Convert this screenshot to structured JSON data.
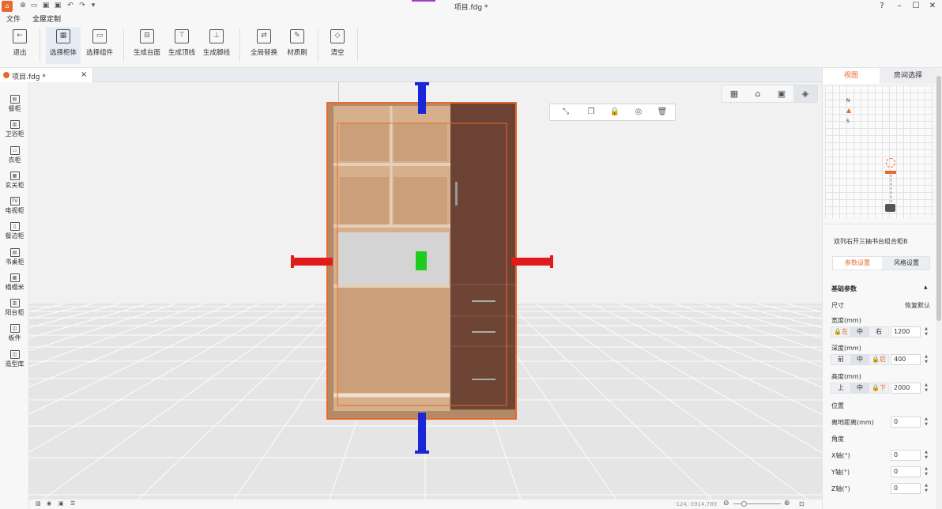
{
  "titlebar": {
    "title": "项目.fdg *",
    "help": "?",
    "min": "–",
    "max": "☐",
    "close": "✕"
  },
  "menu": {
    "items": [
      "文件",
      "全屋定制"
    ]
  },
  "ribbon": {
    "buttons": [
      {
        "label": "退出",
        "icon": "←"
      },
      {
        "label": "选择柜体",
        "icon": "▦"
      },
      {
        "label": "选择组件",
        "icon": "▭"
      },
      {
        "label": "生成台面",
        "icon": "⊟"
      },
      {
        "label": "生成顶线",
        "icon": "⊤"
      },
      {
        "label": "生成脚线",
        "icon": "⊥"
      },
      {
        "label": "全局替换",
        "icon": "⇄"
      },
      {
        "label": "材质刷",
        "icon": "✎"
      },
      {
        "label": "清空",
        "icon": "◇"
      }
    ]
  },
  "doc_tab": {
    "title": "项目.fdg *",
    "close": "×"
  },
  "left_sidebar": {
    "items": [
      {
        "label": "餐柜",
        "icon": "▤"
      },
      {
        "label": "卫浴柜",
        "icon": "▥"
      },
      {
        "label": "衣柜",
        "icon": "▭"
      },
      {
        "label": "玄关柜",
        "icon": "▦"
      },
      {
        "label": "电视柜",
        "icon": "TV"
      },
      {
        "label": "餐边柜",
        "icon": "▯"
      },
      {
        "label": "书桌柜",
        "icon": "▤"
      },
      {
        "label": "榻榻米",
        "icon": "▦"
      },
      {
        "label": "阳台柜",
        "icon": "▥"
      },
      {
        "label": "板件",
        "icon": "◫"
      },
      {
        "label": "造型库",
        "icon": "◫"
      }
    ]
  },
  "viewport": {
    "view_buttons": [
      "▦",
      "⌂",
      "▣",
      "◈"
    ],
    "context_buttons": [
      "⤡",
      "❐",
      "🔒",
      "◎",
      "🗑"
    ]
  },
  "status": {
    "coords": "-124,-3914,789",
    "zoom_minus": "⊖",
    "zoom_plus": "⊕"
  },
  "right_panel": {
    "tabs": [
      "视图",
      "房间选择"
    ],
    "compass_n": "N",
    "compass_s": "S",
    "cabinet_name": "双列右开三抽书台组合柜B",
    "sub_tabs": [
      "参数设置",
      "风格设置"
    ],
    "section_basic": "基础参数",
    "collapse": "▲",
    "size_label": "尺寸",
    "size_default": "恢复默认",
    "width": {
      "label": "宽度(mm)",
      "options": [
        "🔒左",
        "中",
        "右"
      ],
      "value": "1200"
    },
    "depth": {
      "label": "深度(mm)",
      "options": [
        "前",
        "中",
        "🔒后"
      ],
      "value": "400"
    },
    "height": {
      "label": "高度(mm)",
      "options": [
        "上",
        "中",
        "🔒下"
      ],
      "value": "2000"
    },
    "position_label": "位置",
    "floor_dist": {
      "label": "离地距离(mm)",
      "value": "0"
    },
    "angle_label": "角度",
    "x_axis": {
      "label": "X轴(°)",
      "value": "0"
    },
    "y_axis": {
      "label": "Y轴(°)",
      "value": "0"
    },
    "z_axis": {
      "label": "Z轴(°)",
      "value": "0"
    }
  },
  "colors": {
    "accent": "#e8692e",
    "axis_x": "#e01b1b",
    "axis_y": "#1a27d6",
    "axis_z": "#1ecb1e",
    "wood_light": "#c9a07a",
    "wood_dark": "#6b4233"
  }
}
